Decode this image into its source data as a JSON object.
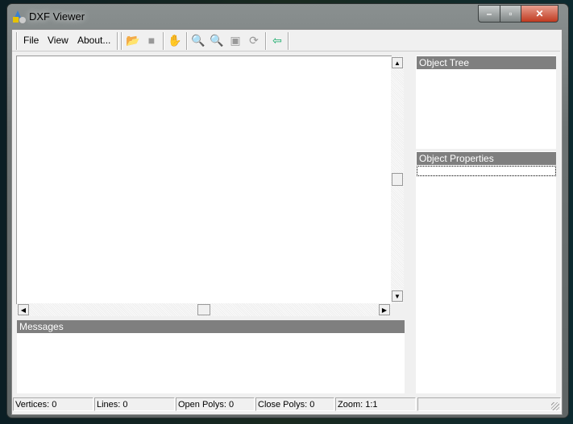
{
  "window": {
    "title": "DXF Viewer",
    "minimize": "–",
    "maximize": "▫",
    "close": "✕"
  },
  "menu": {
    "file": "File",
    "view": "View",
    "about": "About..."
  },
  "toolbar": {
    "open": "open-folder-icon",
    "save": "save-icon",
    "pan": "pan-hand-icon",
    "zoom_in": "zoom-in-icon",
    "zoom_out": "zoom-out-icon",
    "zoom_extents": "zoom-extents-icon",
    "refresh": "refresh-icon",
    "exit": "exit-icon"
  },
  "panels": {
    "messages": "Messages",
    "object_tree": "Object Tree",
    "object_properties": "Object Properties"
  },
  "status": {
    "vertices": "Vertices: 0",
    "lines": "Lines: 0",
    "open_polys": "Open Polys: 0",
    "close_polys": "Close Polys: 0",
    "zoom": "Zoom: 1:1"
  }
}
